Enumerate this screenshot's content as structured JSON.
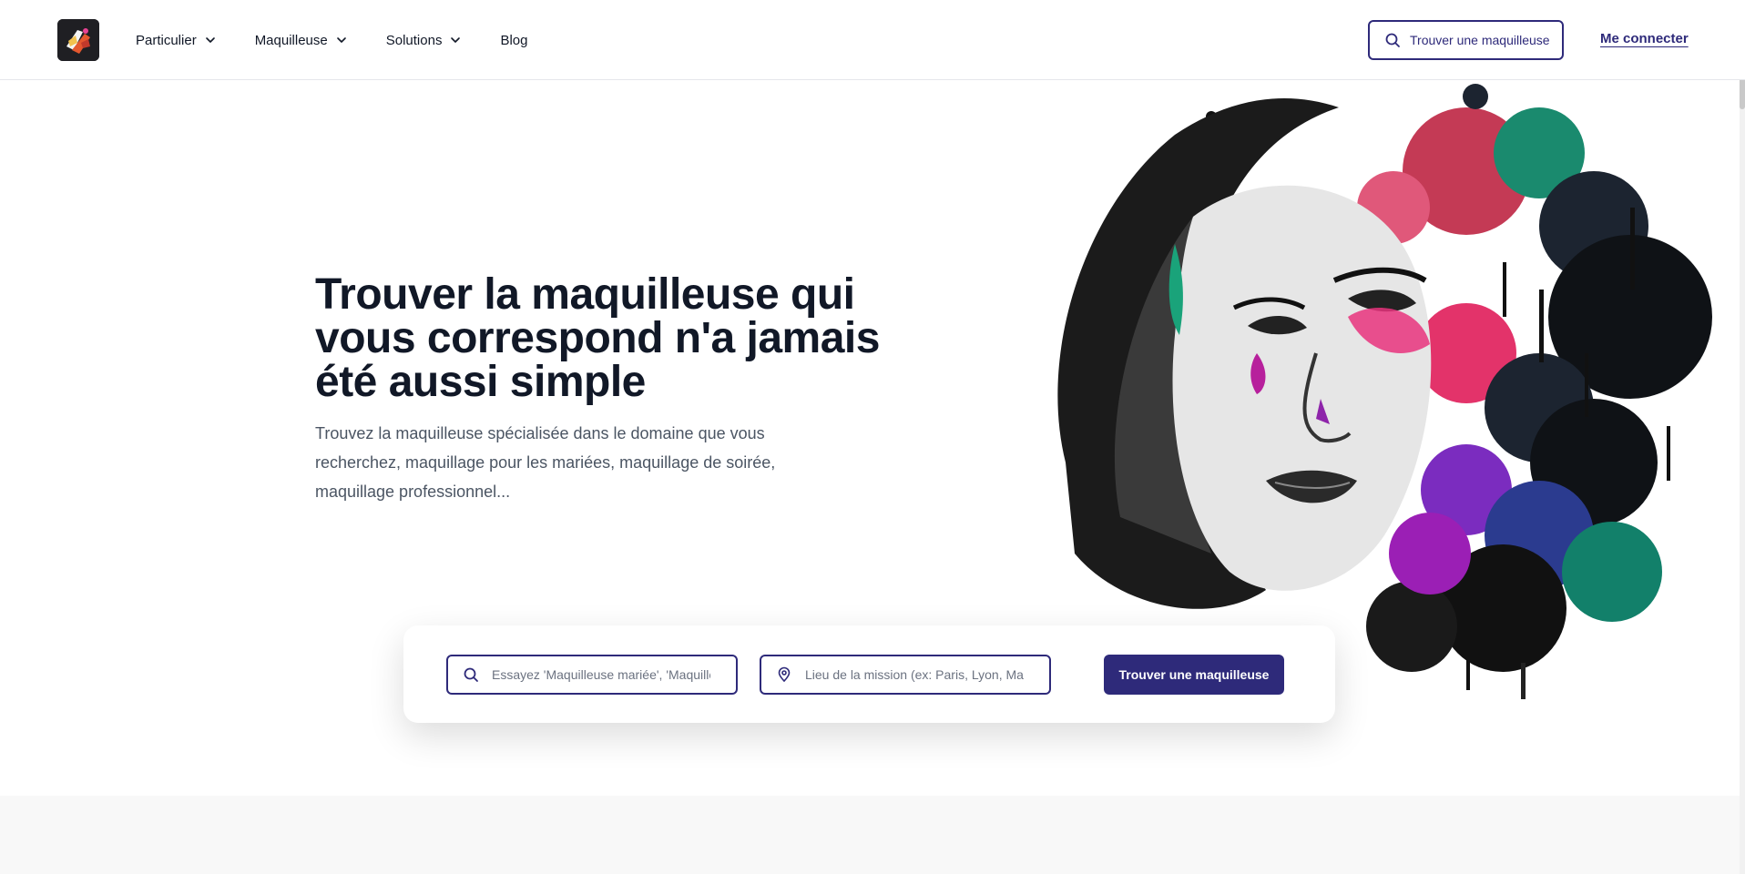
{
  "nav": {
    "items": [
      {
        "label": "Particulier",
        "has_dropdown": true
      },
      {
        "label": "Maquilleuse",
        "has_dropdown": true
      },
      {
        "label": "Solutions",
        "has_dropdown": true
      },
      {
        "label": "Blog",
        "has_dropdown": false
      }
    ]
  },
  "header": {
    "search_label": "Trouver une maquilleuse",
    "login_label": "Me connecter"
  },
  "hero": {
    "title": "Trouver la maquilleuse qui vous correspond n'a jamais été aussi simple",
    "subtitle": "Trouvez la maquilleuse spécialisée dans le domaine que vous recherchez, maquillage pour les mariées, maquillage de soirée, maquillage professionnel..."
  },
  "search": {
    "what_placeholder": "Essayez 'Maquilleuse mariée', 'Maquilleuse soirée'...",
    "where_placeholder": "Lieu de la mission (ex: Paris, Lyon, Marseille...)",
    "submit_label": "Trouver une maquilleuse"
  },
  "colors": {
    "brand": "#2e2a7a",
    "text": "#111827",
    "muted": "#4b5563"
  },
  "icons": {
    "search": "search-icon",
    "location": "map-pin-icon",
    "dropdown": "chevron-down-icon"
  }
}
